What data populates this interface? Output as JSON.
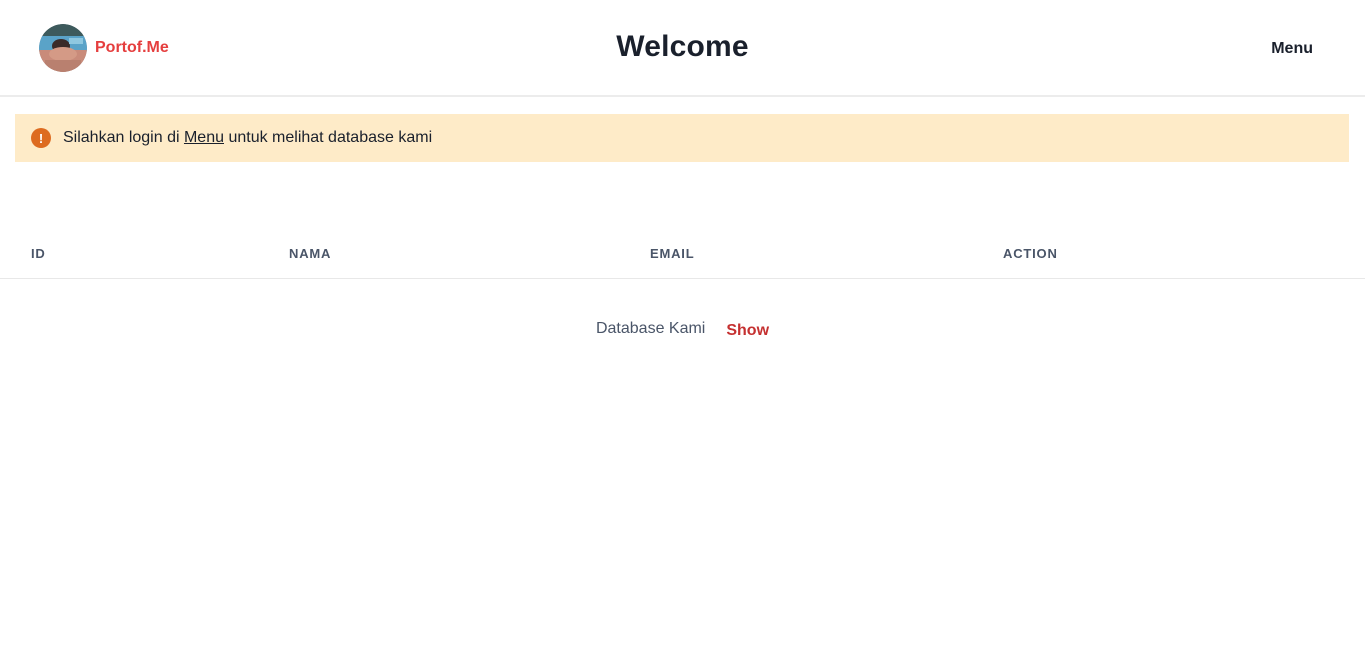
{
  "header": {
    "brand_name": "Portof.Me",
    "title": "Welcome",
    "menu_label": "Menu"
  },
  "alert": {
    "icon": "exclamation-icon",
    "prefix": "Silahkan login di ",
    "link_text": "Menu",
    "suffix": " untuk melihat database kami",
    "color": "#feebc8",
    "icon_color": "#dd6b20"
  },
  "table": {
    "columns": [
      "ID",
      "NAMA",
      "EMAIL",
      "ACTION"
    ]
  },
  "footer": {
    "label": "Database Kami",
    "show_label": "Show"
  },
  "colors": {
    "brand": "#e53e3e",
    "show": "#c53030"
  }
}
